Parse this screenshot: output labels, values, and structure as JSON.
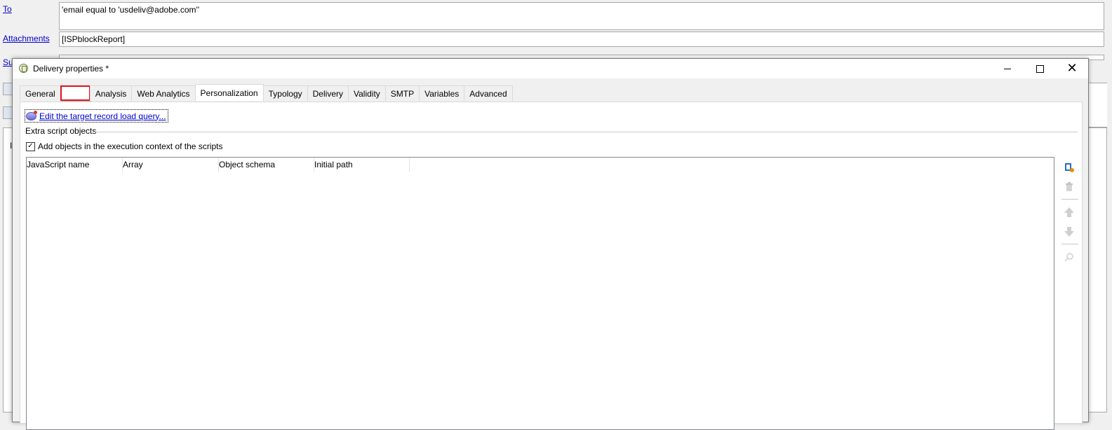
{
  "background": {
    "to_label": "To",
    "to_value": "'email equal to 'usdeliv@adobe.com''",
    "attachments_label": "Attachments",
    "attachments_value": "[ISPblockReport]",
    "subject_label_partial": "Sul",
    "body_partial": "I"
  },
  "dialog": {
    "title": "Delivery properties *",
    "window_buttons": {
      "minimize": "minimize-icon",
      "maximize": "maximize-icon",
      "close": "close-icon"
    }
  },
  "tabs": [
    {
      "label": "General"
    },
    {
      "label": ""
    },
    {
      "label": "Analysis"
    },
    {
      "label": "Web Analytics"
    },
    {
      "label": "Personalization"
    },
    {
      "label": "Typology"
    },
    {
      "label": "Delivery"
    },
    {
      "label": "Validity"
    },
    {
      "label": "SMTP"
    },
    {
      "label": "Variables"
    },
    {
      "label": "Advanced"
    }
  ],
  "active_tab": "Personalization",
  "personalization": {
    "query_link": "Edit the target record load query...",
    "group_label": "Extra script objects",
    "checkbox_label": "Add objects in the execution context of the scripts",
    "checkbox_checked": true,
    "columns": [
      "JavaScript name",
      "Array",
      "Object schema",
      "Initial path"
    ],
    "rows": []
  },
  "colors": {
    "highlight_border": "#e0141e",
    "link": "#0000cc"
  }
}
